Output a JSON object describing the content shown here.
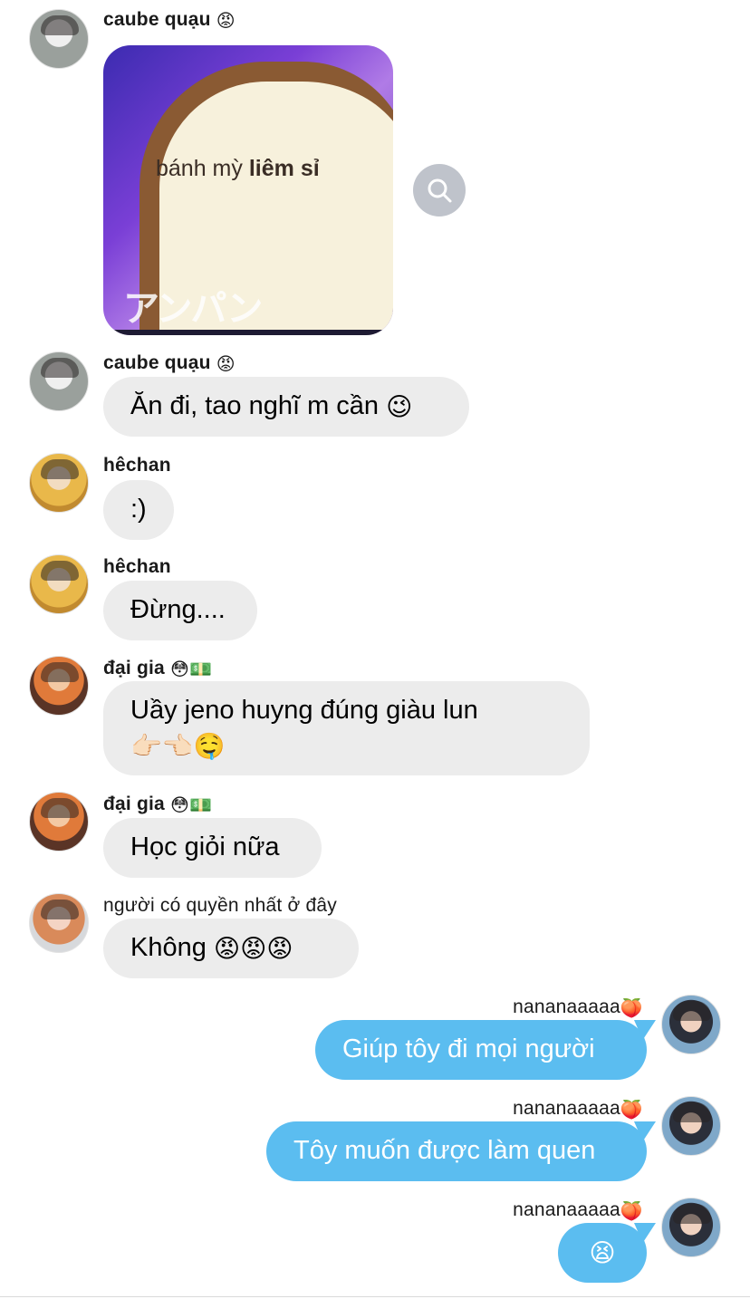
{
  "messages": [
    {
      "sender": "caube quạu",
      "sender_emoji": "😡",
      "type": "image",
      "image": {
        "text_normal": "bánh mỳ",
        "text_bold": "liêm sỉ",
        "text_bottom": "アンパン"
      },
      "zoom_icon": "magnifier-icon"
    },
    {
      "sender": "caube quạu",
      "sender_emoji": "😡",
      "text": "Ăn đi, tao nghĩ m cần",
      "emoji": "😉"
    },
    {
      "sender": "hêchan",
      "text": ":)"
    },
    {
      "sender": "hêchan",
      "text": "Đừng...."
    },
    {
      "sender": "đại gia",
      "sender_emoji": "😳💵",
      "text": "Uầy jeno huyng đúng giàu lun",
      "text2": "👉🏻👈🏻🤤"
    },
    {
      "sender": "đại gia",
      "sender_emoji": "😳💵",
      "text": "Học giỏi nữa"
    },
    {
      "sender": "người có quyền nhất ở đây",
      "text": "Không",
      "emoji": "😡😡😡"
    },
    {
      "sender": "nananaaaaa",
      "sender_emoji": "🍑",
      "text": "Giúp tôy đi mọi người"
    },
    {
      "sender": "nananaaaaa",
      "sender_emoji": "🍑",
      "text": "Tôy muốn được làm quen"
    },
    {
      "sender": "nananaaaaa",
      "sender_emoji": "🍑",
      "text": "",
      "emoji": "😫"
    }
  ],
  "colors": {
    "incoming_bubble": "#ececec",
    "outgoing_bubble": "#5bbdf0",
    "outgoing_text": "#ffffff",
    "zoom_button": "#bfc3cb"
  }
}
